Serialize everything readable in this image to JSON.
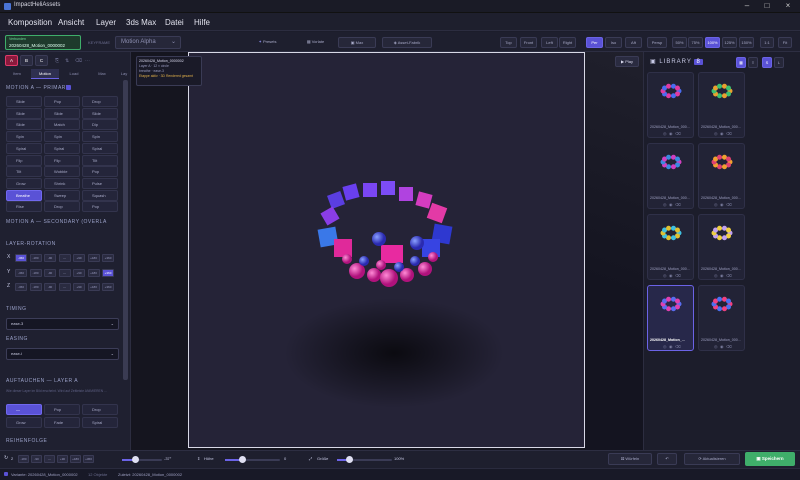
{
  "window": {
    "title": "ImpactHeliAssets"
  },
  "menu": [
    "Komposition",
    "Ansicht",
    "Layer",
    "3ds Max",
    "Datei",
    "Hilfe"
  ],
  "toolbar": {
    "status": "Verbunden",
    "name": "20260428_Motion_0000002",
    "keyframe_label": "KEYFRAME",
    "motion_select": "Motion Alpha",
    "tabs": [
      "Presets",
      "Vorlate",
      "Max",
      "Asset-Fabrik"
    ],
    "views": [
      "Top",
      "Front",
      "Left",
      "Right",
      "Per",
      "Iso",
      "Aft",
      "Persp"
    ],
    "zoom": [
      "50%",
      "75%",
      "100%",
      "125%",
      "150%"
    ],
    "fit": "Fit",
    "extra": "1:1"
  },
  "left": {
    "layers": [
      "A",
      "B",
      "C"
    ],
    "tabs": [
      "Item",
      "Motion",
      "Load",
      "Max",
      "Lay"
    ],
    "primary_title": "MOTION A — PRIMARY",
    "buttons": [
      [
        "Slide",
        "Pop",
        "Drop"
      ],
      [
        "Slide",
        "Slide",
        "Slide"
      ],
      [
        "Slide",
        "Match",
        "Dip"
      ],
      [
        "Spin",
        "Spin",
        "Spin"
      ],
      [
        "Spiral",
        "Spiral",
        "Spiral"
      ],
      [
        "Flip",
        "Flip",
        "Tilt"
      ],
      [
        "Tilt",
        "Wobble",
        "Pop"
      ],
      [
        "Grow",
        "Shrink",
        "Pulse"
      ],
      [
        "Breathe",
        "Sweep",
        "Squash"
      ],
      [
        "Rise",
        "Drop",
        "Pop"
      ]
    ],
    "secondary_title": "MOTION A — SECONDARY (OVERLA",
    "rotation_title": "LAYER-ROTATION",
    "axes": [
      "X",
      "Y",
      "Z"
    ],
    "axis_vals": [
      "-360",
      "-180",
      "-90",
      "—",
      "+90",
      "+180",
      "+360"
    ],
    "timing_title": "TIMING",
    "timing_value": "ease-3",
    "easing_title": "EASING",
    "easing_value": "ease-i",
    "auftauchen_title": "AUFTAUCHEN — LAYER A",
    "auftauchen_note": "Wie dieser Layer im Bild erscheint. Wird auf Zeitleiste ANIMIEREN ...",
    "appear": [
      [
        "—",
        "Pop",
        "Drop"
      ],
      [
        "Grow",
        "Fade",
        "Spiral"
      ]
    ],
    "reihenfolge_title": "REIHENFOLGE"
  },
  "stage": {
    "info_title": "20260428_Motion_0000002",
    "info_layer": "Layer A · 12 × circle",
    "info_breathe": "breathe · ease-3",
    "info_status": "Etappe aktiv · 3D Rendered gesamt",
    "play": "Play"
  },
  "library": {
    "title": "LIBRARY",
    "count": "8",
    "items": [
      {
        "label": "20260428_Motion_000...",
        "selected": false
      },
      {
        "label": "20260428_Motion_000...",
        "selected": false
      },
      {
        "label": "20260428_Motion_000...",
        "selected": false
      },
      {
        "label": "20260428_Motion_000...",
        "selected": false
      },
      {
        "label": "20260428_Motion_000...",
        "selected": false
      },
      {
        "label": "20260428_Motion_000...",
        "selected": false
      },
      {
        "label": "20260428_Motion_...",
        "selected": true
      },
      {
        "label": "20260428_Motion_000...",
        "selected": false
      }
    ]
  },
  "bottom": {
    "frame": "2",
    "rotation_label": "-37°",
    "hoehe_label": "Höhe",
    "hoehe_value": "0",
    "groesse_label": "Größe",
    "groesse_value": "100%",
    "wuerfeln": "Würfeln",
    "aktualisieren": "Aktualisieren",
    "speichern": "Speichern"
  },
  "status": {
    "variant": "Variante: 20260428_Motion_0000002",
    "objects": "12 Objekte",
    "render": "Zuletzt: 20260428_Motion_0000002"
  },
  "colors": {
    "accent": "#5a52d6",
    "green": "#3fae6a",
    "bg": "#1c1d2b"
  }
}
